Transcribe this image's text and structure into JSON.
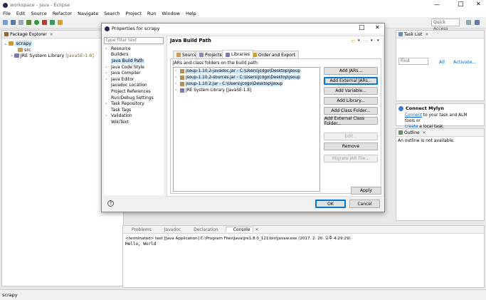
{
  "window": {
    "title": "workspace - Java - Eclipse",
    "min": "—",
    "max": "□",
    "close": "✕"
  },
  "menubar": [
    "File",
    "Edit",
    "Source",
    "Refactor",
    "Navigate",
    "Search",
    "Project",
    "Run",
    "Window",
    "Help"
  ],
  "quick_access": {
    "placeholder": "Quick Access"
  },
  "package_explorer": {
    "title": "Package Explorer",
    "project": "scrapy",
    "src": "src",
    "jre": "JRE System Library",
    "jre_suffix": "[JavaSE-1.8]"
  },
  "task_list": {
    "title": "Task List",
    "find_placeholder": "Find",
    "all": "All",
    "activate": "Activate..."
  },
  "mylyn": {
    "title": "Connect Mylyn",
    "link1": "Connect",
    "text1": " to your task and ALM tools or",
    "link2": "create",
    "text2": " a local task."
  },
  "outline": {
    "title": "Outline",
    "message": "An outline is not available."
  },
  "console": {
    "tabs": [
      "Problems",
      "Javadoc",
      "Declaration",
      "Console"
    ],
    "active_tab": "Console",
    "terminated": "<terminated> test [Java Application] C:\\Program Files\\Java\\jre1.8.0_121\\bin\\javaw.exe (2017. 2. 20. 오후 4:29:29)",
    "output": "Hello, World"
  },
  "status_bar": {
    "text": "scrapy"
  },
  "dialog": {
    "title": "Properties for scrapy",
    "filter_placeholder": "type filter text",
    "nav": [
      {
        "label": "Resource",
        "expand": true
      },
      {
        "label": "Builders",
        "expand": false
      },
      {
        "label": "Java Build Path",
        "expand": false,
        "selected": true
      },
      {
        "label": "Java Code Style",
        "expand": true
      },
      {
        "label": "Java Compiler",
        "expand": true
      },
      {
        "label": "Java Editor",
        "expand": true
      },
      {
        "label": "Javadoc Location",
        "expand": false
      },
      {
        "label": "Project References",
        "expand": false
      },
      {
        "label": "Run/Debug Settings",
        "expand": false
      },
      {
        "label": "Task Repository",
        "expand": true
      },
      {
        "label": "Task Tags",
        "expand": false
      },
      {
        "label": "Validation",
        "expand": true
      },
      {
        "label": "WikiText",
        "expand": false
      }
    ],
    "heading": "Java Build Path",
    "tabs": [
      "Source",
      "Projects",
      "Libraries",
      "Order and Export"
    ],
    "active_tab": "Libraries",
    "list_label": "JARs and class folders on the build path:",
    "entries": [
      {
        "label": "jsoup-1.10.2-javadoc.jar - C:\\Users\\jcdgo\\Desktop\\jsoup",
        "selected": true
      },
      {
        "label": "jsoup-1.10.2-sources.jar - C:\\Users\\jcdgo\\Desktop\\jsoup",
        "selected": true
      },
      {
        "label": "jsoup-1.10.2.jar - C:\\Users\\jcdgo\\Desktop\\jsoup",
        "selected": true
      },
      {
        "label": "JRE System Library [JavaSE-1.8]",
        "selected": false
      }
    ],
    "buttons": {
      "add_jars": "Add JARs...",
      "add_external_jars": "Add External JARs...",
      "add_variable": "Add Variable...",
      "add_library": "Add Library...",
      "add_class_folder": "Add Class Folder...",
      "add_external_class_folder": "Add External Class Folder...",
      "edit": "Edit...",
      "remove": "Remove",
      "migrate": "Migrate JAR File...",
      "apply": "Apply",
      "ok": "OK",
      "cancel": "Cancel",
      "help": "?"
    }
  },
  "colors": {
    "accent": "#0078d7",
    "selection": "#cce8ff",
    "link": "#0066cc",
    "titlebar": "#ffffff"
  }
}
